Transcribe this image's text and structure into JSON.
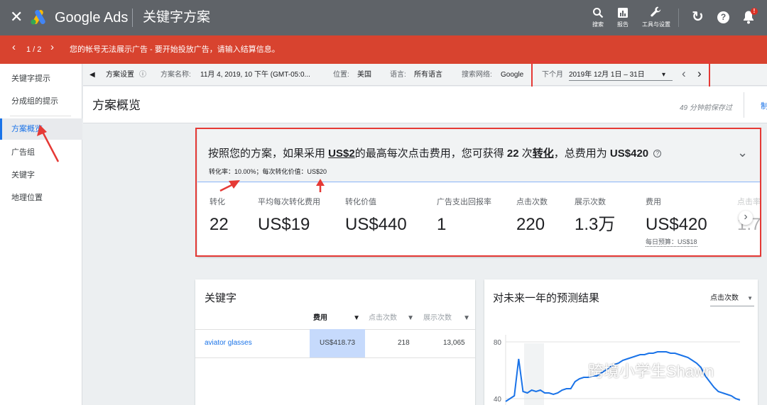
{
  "topbar": {
    "close": "✕",
    "brand": "Google Ads",
    "title": "关键字方案",
    "search_label": "搜索",
    "reports_label": "报告",
    "tools_label": "工具与设置",
    "refresh": "↻",
    "help": "?",
    "notif_count": "!"
  },
  "alert": {
    "pager": "1 / 2",
    "prev": "‹",
    "next": "›",
    "message": "您的帐号无法展示广告 - 要开始投放广告，请输入结算信息。"
  },
  "sidebar": {
    "items": [
      {
        "label": "关键字提示"
      },
      {
        "label": "分成组的提示"
      },
      {
        "label": "方案概览"
      },
      {
        "label": "广告组"
      },
      {
        "label": "关键字"
      },
      {
        "label": "地理位置"
      }
    ]
  },
  "settings": {
    "collapse": "◀",
    "settings_label": "方案设置",
    "info": "ⓘ",
    "plan_name_label": "方案名称:",
    "plan_name": "11月 4, 2019, 10 下午 (GMT-05:0...",
    "location_label": "位置:",
    "location": "美国",
    "language_label": "语言:",
    "language": "所有语言",
    "network_label": "搜索网络:",
    "network": "Google",
    "period_label": "下个月",
    "period": "2019年 12月 1日 – 31日",
    "dropdown": "▾",
    "prev": "‹",
    "next": "›"
  },
  "overview": {
    "title": "方案概览",
    "saved": "49 分钟前保存过",
    "action": "制"
  },
  "summary": {
    "headline_prefix": "按照您的方案，如果采用 ",
    "headline_bid": "US$2",
    "headline_mid": "的最高每次点击费用，您可获得 ",
    "headline_conv": "22",
    "headline_mid2": " 次",
    "headline_conv_word": "转化",
    "headline_mid3": "，总费用为 ",
    "headline_cost": "US$420",
    "help": "?",
    "sub": "转化率：10.00%；每次转化价值：US$20",
    "expand": "⌄",
    "metrics": [
      {
        "label": "转化",
        "value": "22"
      },
      {
        "label": "平均每次转化费用",
        "value": "US$19"
      },
      {
        "label": "转化价值",
        "value": "US$440"
      },
      {
        "label": "广告支出回报率",
        "value": "1"
      },
      {
        "label": "点击次数",
        "value": "220"
      },
      {
        "label": "展示次数",
        "value": "1.3万"
      },
      {
        "label": "费用",
        "value": "US$420"
      },
      {
        "label": "点击率",
        "value": "1.7"
      }
    ],
    "daily_budget": "每日预算：US$18",
    "next_arrow": "›"
  },
  "keywords": {
    "title": "关键字",
    "columns": [
      "费用",
      "点击次数",
      "展示次数"
    ],
    "sort": "▼",
    "rows": [
      {
        "keyword": "aviator glasses",
        "cost": "US$418.73",
        "clicks": "218",
        "impressions": "13,065"
      }
    ]
  },
  "forecast": {
    "title": "对未来一年的预测结果",
    "metric": "点击次数",
    "dropdown": "▼"
  },
  "watermark": "跨境小学生Shawn",
  "chart_data": {
    "type": "line",
    "title": "对未来一年的预测结果",
    "xlabel": "",
    "ylabel": "点击次数",
    "yticks": [
      80,
      40
    ],
    "ylim": [
      35,
      85
    ],
    "grid": true,
    "series": [
      {
        "values": [
          38,
          40,
          42,
          68,
          45,
          44,
          46,
          45,
          46,
          44,
          44,
          43,
          44,
          46,
          47,
          47,
          52,
          54,
          55,
          55,
          56,
          56,
          58,
          60,
          62,
          64,
          65,
          67,
          68,
          69,
          70,
          71,
          71,
          72,
          72,
          73,
          73,
          73,
          72,
          72,
          71,
          70,
          69,
          67,
          65,
          62,
          56,
          52,
          48,
          45,
          44,
          43,
          42,
          40,
          39
        ]
      }
    ],
    "color": "#1a73e8"
  }
}
